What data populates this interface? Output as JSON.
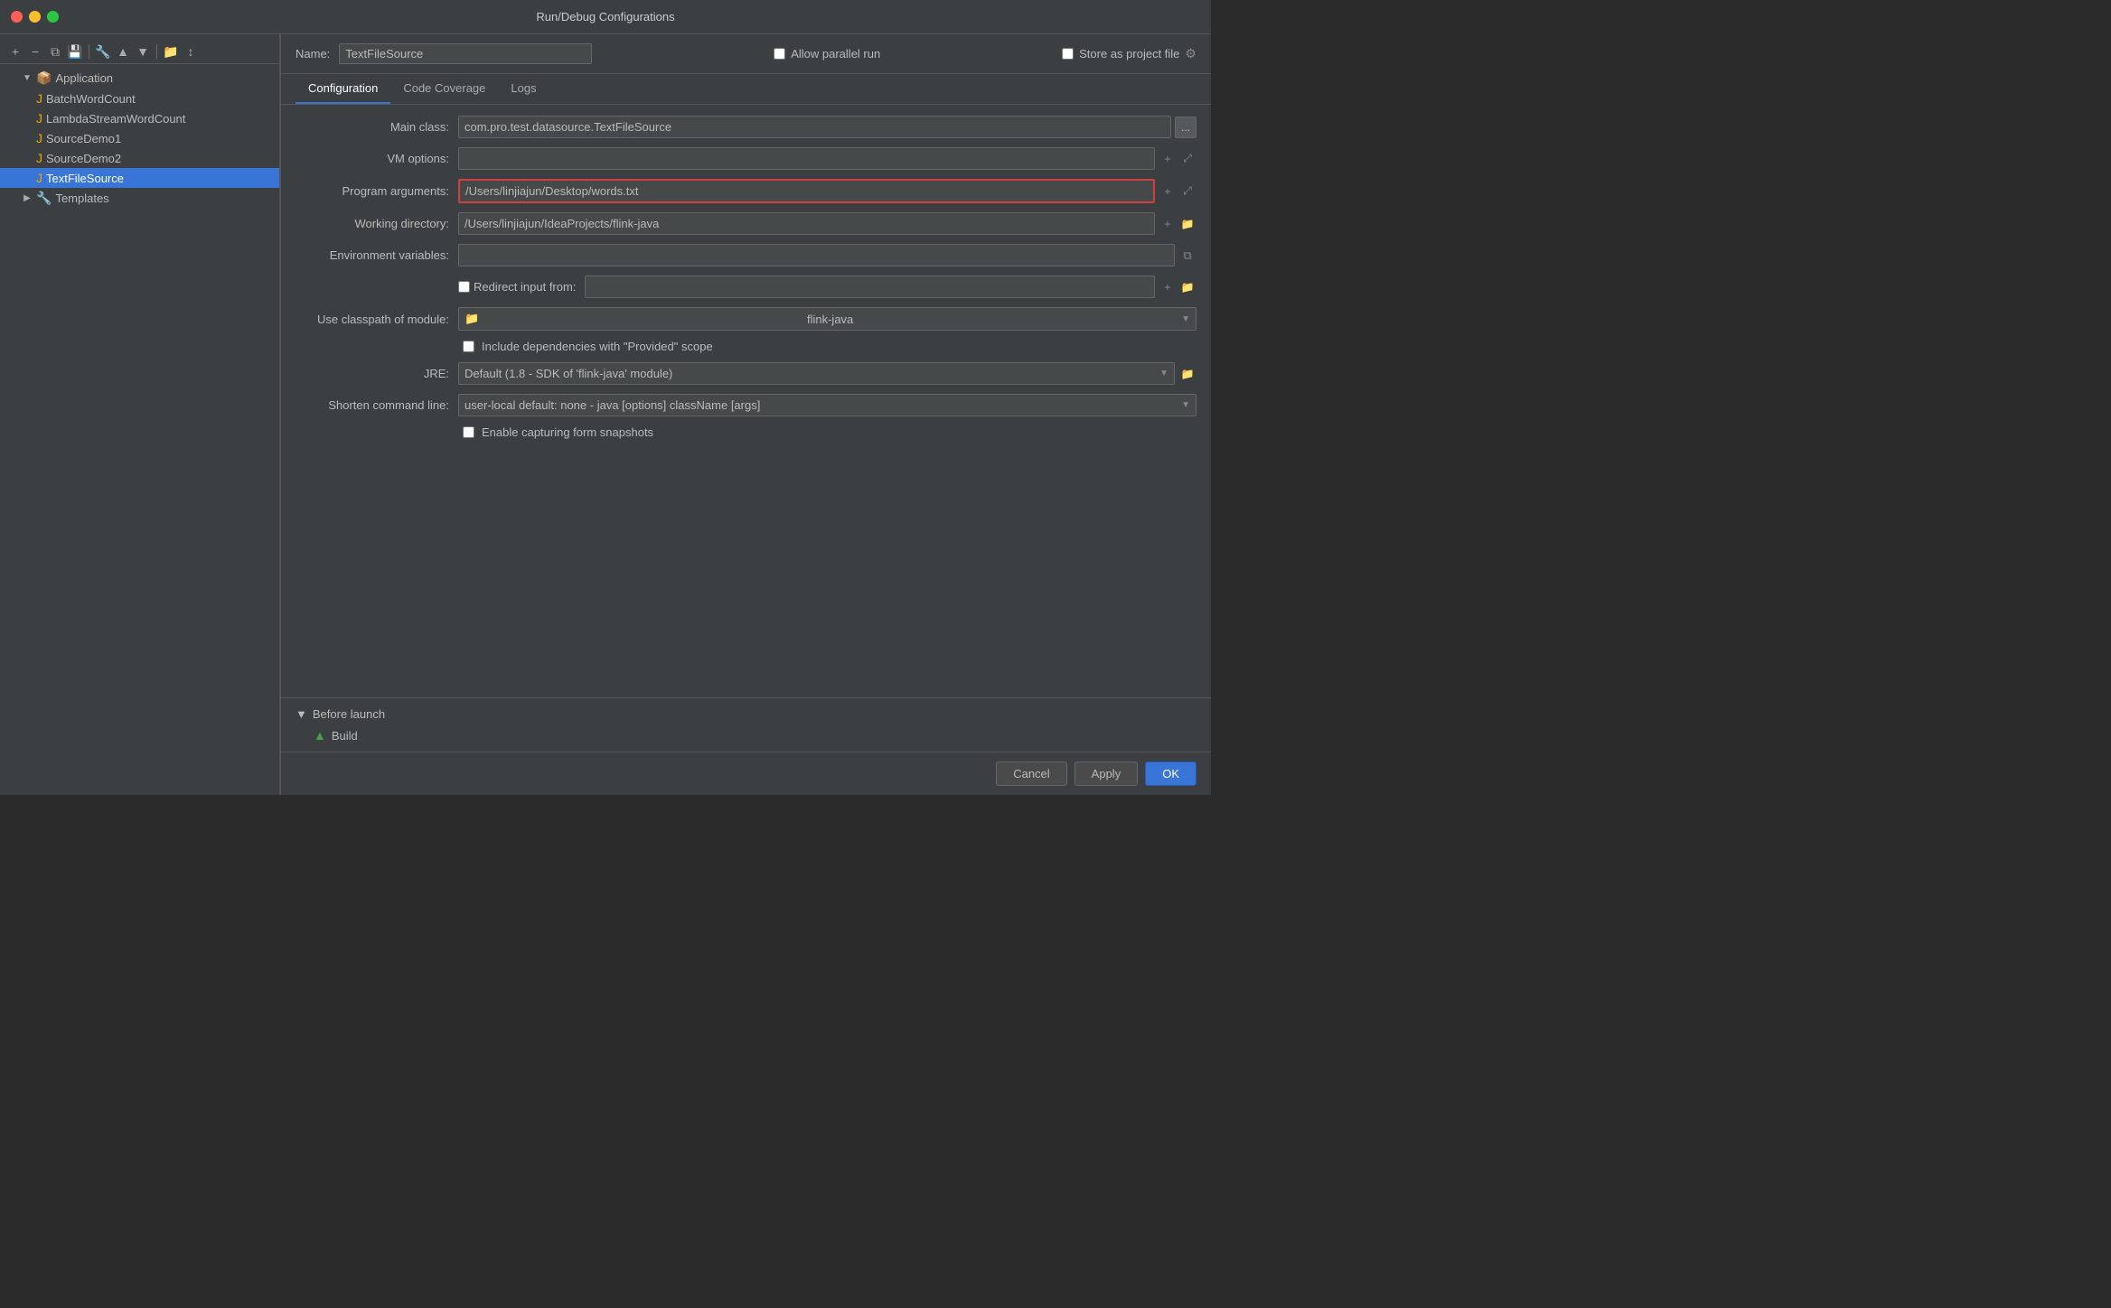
{
  "titlebar": {
    "title": "Run/Debug Configurations"
  },
  "sidebar": {
    "toolbar_buttons": [
      "+",
      "−",
      "⧉",
      "💾",
      "🔧",
      "▲",
      "▼",
      "📁",
      "↕"
    ],
    "items": [
      {
        "id": "application",
        "label": "Application",
        "indent": 1,
        "type": "group",
        "expanded": true,
        "icon": "📦"
      },
      {
        "id": "batchwordcount",
        "label": "BatchWordCount",
        "indent": 2,
        "type": "item",
        "icon": "J"
      },
      {
        "id": "lambdastreamwordcount",
        "label": "LambdaStreamWordCount",
        "indent": 2,
        "type": "item",
        "icon": "J"
      },
      {
        "id": "sourcedemo1",
        "label": "SourceDemo1",
        "indent": 2,
        "type": "item",
        "icon": "J"
      },
      {
        "id": "sourcedemo2",
        "label": "SourceDemo2",
        "indent": 2,
        "type": "item",
        "icon": "J"
      },
      {
        "id": "textfilesource",
        "label": "TextFileSource",
        "indent": 2,
        "type": "item",
        "icon": "J",
        "selected": true
      },
      {
        "id": "templates",
        "label": "Templates",
        "indent": 1,
        "type": "group",
        "expanded": false,
        "icon": "🔧"
      }
    ]
  },
  "name_field": {
    "label": "Name:",
    "value": "TextFileSource"
  },
  "allow_parallel": {
    "label": "Allow parallel run",
    "checked": false
  },
  "store_as_project": {
    "label": "Store as project file",
    "checked": false
  },
  "tabs": [
    {
      "id": "configuration",
      "label": "Configuration",
      "active": true
    },
    {
      "id": "code_coverage",
      "label": "Code Coverage",
      "active": false
    },
    {
      "id": "logs",
      "label": "Logs",
      "active": false
    }
  ],
  "config": {
    "main_class": {
      "label": "Main class:",
      "value": "com.pro.test.datasource.TextFileSource"
    },
    "vm_options": {
      "label": "VM options:",
      "value": ""
    },
    "program_arguments": {
      "label": "Program arguments:",
      "value": "/Users/linjiajun/Desktop/words.txt"
    },
    "working_directory": {
      "label": "Working directory:",
      "value": "/Users/linjiajun/IdeaProjects/flink-java"
    },
    "environment_variables": {
      "label": "Environment variables:",
      "value": ""
    },
    "redirect_input": {
      "label": "Redirect input from:",
      "checked": false,
      "value": ""
    },
    "use_classpath": {
      "label": "Use classpath of module:",
      "value": "flink-java",
      "icon": "📁"
    },
    "include_dependencies": {
      "label": "Include dependencies with \"Provided\" scope",
      "checked": false
    },
    "jre": {
      "label": "JRE:",
      "value": "Default (1.8 - SDK of 'flink-java' module)"
    },
    "shorten_command_line": {
      "label": "Shorten command line:",
      "value": "user-local default: none - java [options] className [args]"
    },
    "enable_capturing": {
      "label": "Enable capturing form snapshots",
      "checked": false
    }
  },
  "before_launch": {
    "label": "Before launch",
    "items": [
      {
        "id": "build",
        "label": "Build",
        "icon": "▲"
      }
    ]
  },
  "buttons": {
    "cancel": "Cancel",
    "apply": "Apply",
    "ok": "OK"
  }
}
